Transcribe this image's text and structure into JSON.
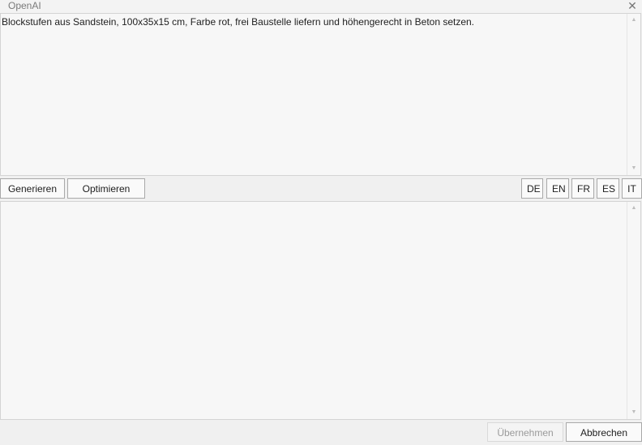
{
  "window": {
    "title": "OpenAI",
    "close_glyph": "✕"
  },
  "input": {
    "text": "Blockstufen aus Sandstein, 100x35x15 cm, Farbe rot, frei Baustelle liefern und höhengerecht in Beton setzen."
  },
  "output": {
    "text": ""
  },
  "toolbar": {
    "generate_label": "Generieren",
    "optimize_label": "Optimieren",
    "languages": [
      "DE",
      "EN",
      "FR",
      "ES",
      "IT"
    ]
  },
  "footer": {
    "apply_label": "Übernehmen",
    "apply_enabled": false,
    "cancel_label": "Abbrechen"
  },
  "scroll": {
    "up_glyph": "▲",
    "down_glyph": "▼"
  }
}
